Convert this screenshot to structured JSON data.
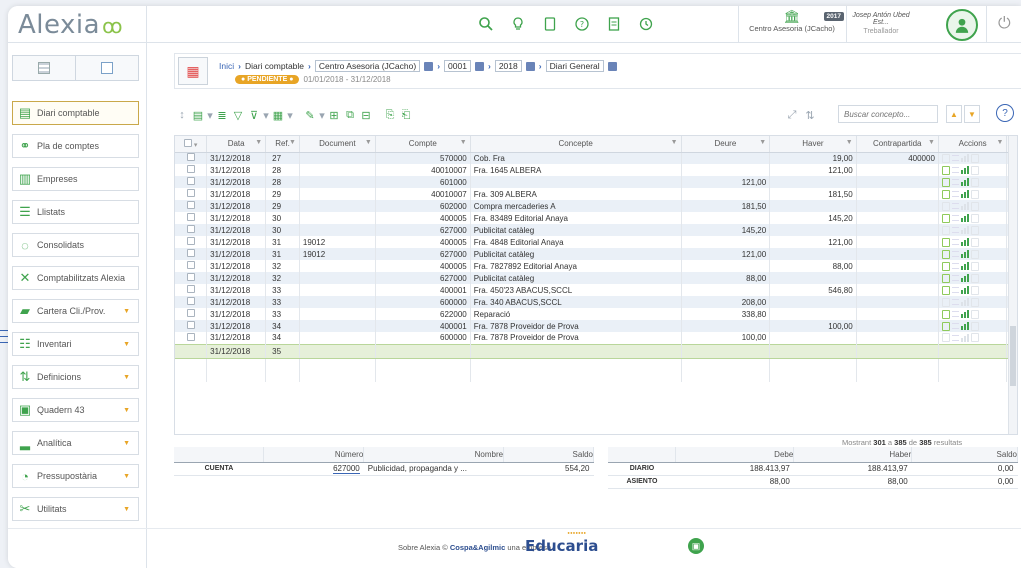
{
  "app": {
    "logo": "Alexia",
    "logo_mark": "ꝏ"
  },
  "topbar": {
    "icons": [
      "search-icon",
      "bulb-icon",
      "document-icon",
      "help-icon",
      "notes-icon",
      "history-icon"
    ],
    "centre_name": "Centro Asesoria (JCacho)",
    "year_badge": "2017",
    "user_name": "Josep Antón Ubed Est...",
    "user_role": "Treballador"
  },
  "sidebar": {
    "items": [
      {
        "label": "Diari comptable",
        "icon": "journal-icon",
        "active": true,
        "expand": false
      },
      {
        "label": "Pla de comptes",
        "icon": "tree-icon",
        "expand": false
      },
      {
        "label": "Empreses",
        "icon": "buildings-icon",
        "expand": false
      },
      {
        "label": "Llistats",
        "icon": "list-icon",
        "expand": false
      },
      {
        "label": "Consolidats",
        "icon": "consolidate-icon",
        "expand": false
      },
      {
        "label": "Comptabilitzats Alexia",
        "icon": "network-icon",
        "expand": false
      },
      {
        "label": "Cartera Cli./Prov.",
        "icon": "folder-icon",
        "expand": true
      },
      {
        "label": "Inventari",
        "icon": "inventory-icon",
        "expand": true
      },
      {
        "label": "Definicions",
        "icon": "sort-icon",
        "expand": true
      },
      {
        "label": "Quadern 43",
        "icon": "notebook-icon",
        "expand": true
      },
      {
        "label": "Analítica",
        "icon": "bars-icon",
        "expand": true
      },
      {
        "label": "Pressupostària",
        "icon": "pie-icon",
        "expand": true
      },
      {
        "label": "Utilitats",
        "icon": "tools-icon",
        "expand": true
      }
    ]
  },
  "breadcrumb": {
    "home": "Inici",
    "current": "Diari comptable",
    "centre": "Centro Asesoria (JCacho)",
    "company": "0001",
    "year": "2018",
    "journal": "Diari General",
    "status": "PENDIENTE",
    "period": "01/01/2018 - 31/12/2018"
  },
  "search": {
    "placeholder": "Buscar concepto..."
  },
  "grid": {
    "headers": [
      "Data",
      "Ref.",
      "Document",
      "Compte",
      "Concepte",
      "Deure",
      "Haver",
      "Contrapartida",
      "Accions"
    ],
    "rows": [
      {
        "data": "31/12/2018",
        "ref": "27",
        "doc": "",
        "compte": "570000",
        "concepte": "Cob. Fra",
        "deure": "",
        "haver": "19,00",
        "contra": "400000",
        "act": "off"
      },
      {
        "data": "31/12/2018",
        "ref": "28",
        "doc": "",
        "compte": "40010007",
        "concepte": "Fra. 1645 ALBERA",
        "deure": "",
        "haver": "121,00",
        "contra": "",
        "act": "on"
      },
      {
        "data": "31/12/2018",
        "ref": "28",
        "doc": "",
        "compte": "601000",
        "concepte": "",
        "deure": "121,00",
        "haver": "",
        "contra": "",
        "act": "on"
      },
      {
        "data": "31/12/2018",
        "ref": "29",
        "doc": "",
        "compte": "40010007",
        "concepte": "Fra. 309 ALBERA",
        "deure": "",
        "haver": "181,50",
        "contra": "",
        "act": "on"
      },
      {
        "data": "31/12/2018",
        "ref": "29",
        "doc": "",
        "compte": "602000",
        "concepte": "Compra mercaderies A",
        "deure": "181,50",
        "haver": "",
        "contra": "",
        "act": "off"
      },
      {
        "data": "31/12/2018",
        "ref": "30",
        "doc": "",
        "compte": "400005",
        "concepte": "Fra. 83489 Editorial Anaya",
        "deure": "",
        "haver": "145,20",
        "contra": "",
        "act": "on"
      },
      {
        "data": "31/12/2018",
        "ref": "30",
        "doc": "",
        "compte": "627000",
        "concepte": "Publicitat catàleg",
        "deure": "145,20",
        "haver": "",
        "contra": "",
        "act": "off"
      },
      {
        "data": "31/12/2018",
        "ref": "31",
        "doc": "19012",
        "compte": "400005",
        "concepte": "Fra. 4848 Editorial Anaya",
        "deure": "",
        "haver": "121,00",
        "contra": "",
        "act": "on"
      },
      {
        "data": "31/12/2018",
        "ref": "31",
        "doc": "19012",
        "compte": "627000",
        "concepte": "Publicitat catàleg",
        "deure": "121,00",
        "haver": "",
        "contra": "",
        "act": "on"
      },
      {
        "data": "31/12/2018",
        "ref": "32",
        "doc": "",
        "compte": "400005",
        "concepte": "Fra. 7827892 Editorial Anaya",
        "deure": "",
        "haver": "88,00",
        "contra": "",
        "act": "on"
      },
      {
        "data": "31/12/2018",
        "ref": "32",
        "doc": "",
        "compte": "627000",
        "concepte": "Publicitat catàleg",
        "deure": "88,00",
        "haver": "",
        "contra": "",
        "act": "on"
      },
      {
        "data": "31/12/2018",
        "ref": "33",
        "doc": "",
        "compte": "400001",
        "concepte": "Fra. 450'23 ABACUS,SCCL",
        "deure": "",
        "haver": "546,80",
        "contra": "",
        "act": "on"
      },
      {
        "data": "31/12/2018",
        "ref": "33",
        "doc": "",
        "compte": "600000",
        "concepte": "Fra. 340 ABACUS,SCCL",
        "deure": "208,00",
        "haver": "",
        "contra": "",
        "act": "off"
      },
      {
        "data": "31/12/2018",
        "ref": "33",
        "doc": "",
        "compte": "622000",
        "concepte": "Reparació",
        "deure": "338,80",
        "haver": "",
        "contra": "",
        "act": "on"
      },
      {
        "data": "31/12/2018",
        "ref": "34",
        "doc": "",
        "compte": "400001",
        "concepte": "Fra. 7878 Proveidor de Prova",
        "deure": "",
        "haver": "100,00",
        "contra": "",
        "act": "on"
      },
      {
        "data": "31/12/2018",
        "ref": "34",
        "doc": "",
        "compte": "600000",
        "concepte": "Fra. 7878 Proveidor de Prova",
        "deure": "100,00",
        "haver": "",
        "contra": "",
        "act": "off"
      }
    ],
    "new_row": {
      "data": "31/12/2018",
      "ref": "35"
    },
    "results_prefix": "Mostrant",
    "results_from": "301",
    "results_mid": "a",
    "results_to": "385",
    "results_de": "de",
    "results_total": "385",
    "results_suffix": "resultats"
  },
  "account": {
    "headers": [
      "",
      "Número",
      "Nombre",
      "Saldo"
    ],
    "label": "CUENTA",
    "number": "627000",
    "name": "Publicidad, propaganda y ...",
    "saldo": "554,20"
  },
  "totals": {
    "headers": [
      "",
      "Debe",
      "Haber",
      "Saldo"
    ],
    "rows": [
      {
        "label": "DIARIO",
        "debe": "188.413,97",
        "haber": "188.413,97",
        "saldo": "0,00"
      },
      {
        "label": "ASIENTO",
        "debe": "88,00",
        "haber": "88,00",
        "saldo": "0,00"
      }
    ]
  },
  "footer": {
    "text1": "Sobre Alexia ©",
    "company": "Cospa&Agilmic",
    "text2": "una empresa",
    "brand": "Educaria"
  },
  "colors": {
    "accent": "#3fa34d",
    "link": "#3a66b5",
    "pending": "#e8a526",
    "row_alt": "#eaf0f7"
  }
}
